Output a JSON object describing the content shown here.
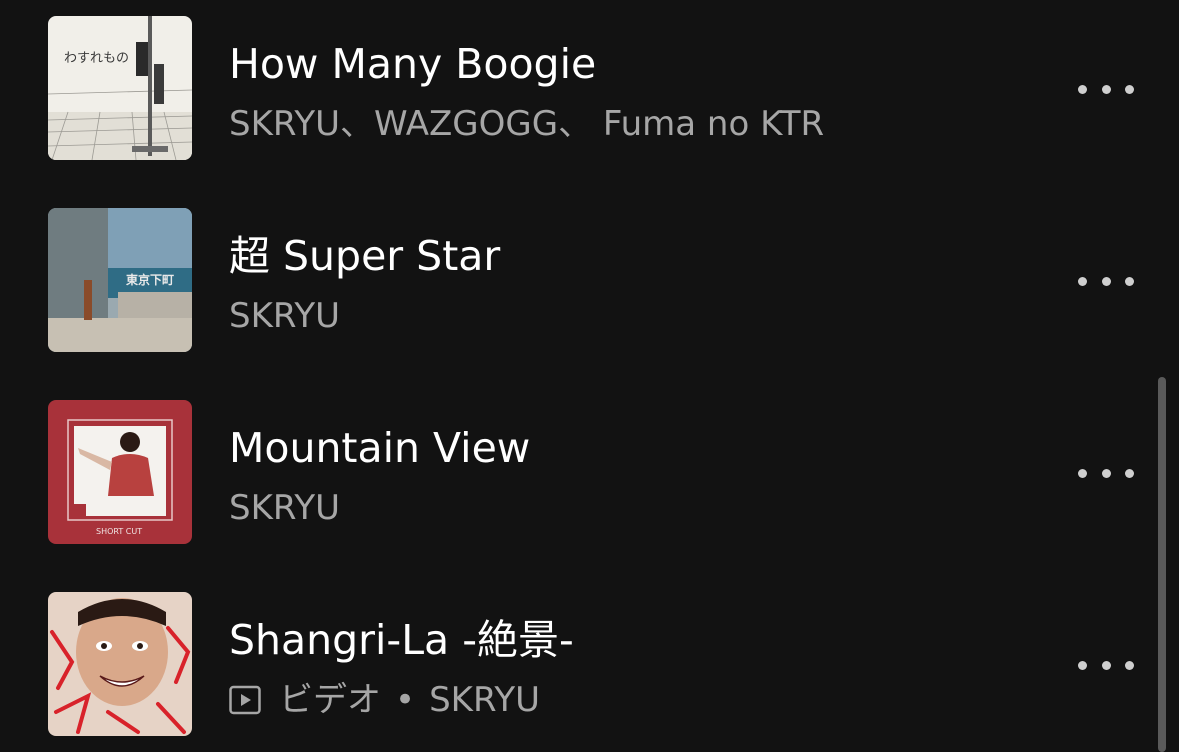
{
  "colors": {
    "background": "#121212",
    "title": "#ffffff",
    "subtitle": "#a6a6a6",
    "scrollbar": "#5a5a5a"
  },
  "tracks": [
    {
      "title": "How Many Boogie",
      "artists": "SKRYU、WAZGOGG、 Fuma no KTR",
      "thumb_text": "わすれもの",
      "more_icon": "more-horizontal-icon"
    },
    {
      "title": "超 Super Star",
      "artists": "SKRYU",
      "thumb_text": "東京下町",
      "more_icon": "more-horizontal-icon"
    },
    {
      "title": "Mountain View",
      "artists": "SKRYU",
      "thumb_text": "SHORT CUT",
      "more_icon": "more-horizontal-icon"
    },
    {
      "title": "Shangri-La -絶景-",
      "type_label": "ビデオ",
      "separator": "•",
      "artists": "SKRYU",
      "type_icon": "video-icon",
      "more_icon": "more-horizontal-icon"
    }
  ]
}
